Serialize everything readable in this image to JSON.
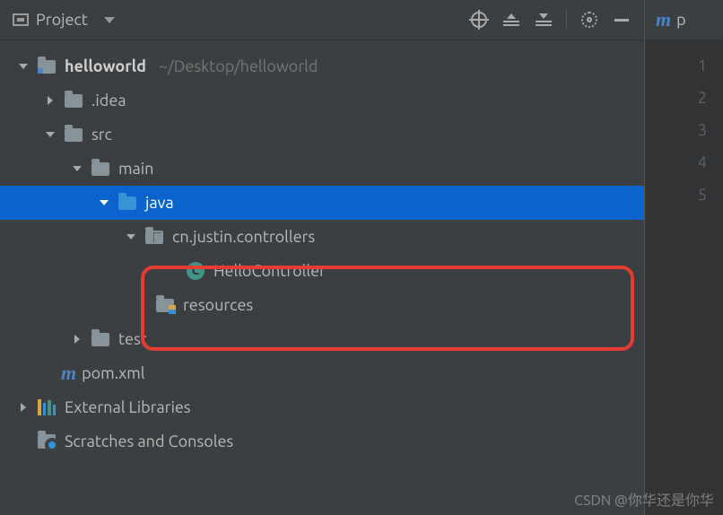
{
  "toolbar": {
    "project_label": "Project"
  },
  "editor": {
    "tab_filename_char": "p",
    "line_numbers": [
      "1",
      "2",
      "3",
      "4",
      "5"
    ]
  },
  "tree": {
    "root": {
      "name": "helloworld",
      "path": "~/Desktop/helloworld"
    },
    "idea": ".idea",
    "src": "src",
    "main": "main",
    "java": "java",
    "pkg": "cn.justin.controllers",
    "cls": "HelloController",
    "resources": "resources",
    "test": "test",
    "pom": "pom.xml",
    "ext_lib": "External Libraries",
    "scratches": "Scratches and Consoles"
  },
  "watermark": "CSDN @你华还是你华"
}
